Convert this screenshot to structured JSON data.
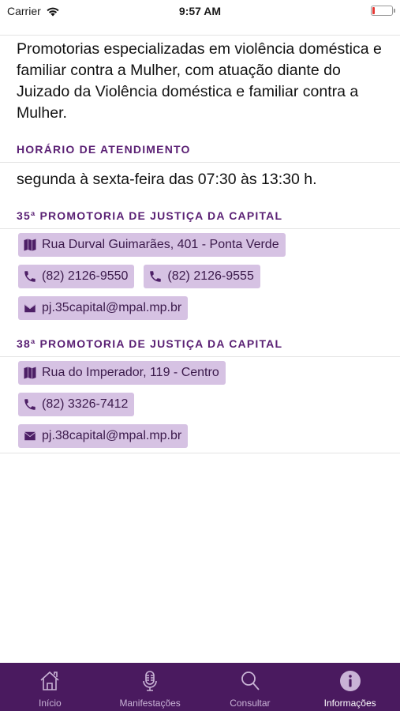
{
  "status_bar": {
    "carrier": "Carrier",
    "time": "9:57 AM"
  },
  "intro_text": "Promotorias especializadas em violência doméstica e familiar contra a Mulher, com atuação diante do Juizado da Violência doméstica e familiar contra a Mulher.",
  "schedule": {
    "header": "HORÁRIO DE ATENDIMENTO",
    "text": "segunda à sexta-feira das 07:30 às 13:30 h."
  },
  "offices": [
    {
      "header": "35ª PROMOTORIA DE JUSTIÇA DA CAPITAL",
      "address": "Rua Durval Guimarães, 401 - Ponta Verde",
      "phones": [
        "(82) 2126-9550",
        "(82) 2126-9555"
      ],
      "email": "pj.35capital@mpal.mp.br"
    },
    {
      "header": "38ª PROMOTORIA DE JUSTIÇA DA CAPITAL",
      "address": "Rua do Imperador, 119 - Centro",
      "phones": [
        "(82) 3326-7412"
      ],
      "email": "pj.38capital@mpal.mp.br"
    }
  ],
  "tab_bar": {
    "tabs": [
      {
        "label": "Início",
        "icon": "home-icon"
      },
      {
        "label": "Manifestações",
        "icon": "microphone-icon"
      },
      {
        "label": "Consultar",
        "icon": "search-icon"
      },
      {
        "label": "Informações",
        "icon": "info-icon"
      }
    ],
    "active": "Informações"
  },
  "colors": {
    "accent": "#5a2074",
    "chip_bg": "#d6c2e3",
    "tab_bar_bg": "#4a1a5f"
  }
}
